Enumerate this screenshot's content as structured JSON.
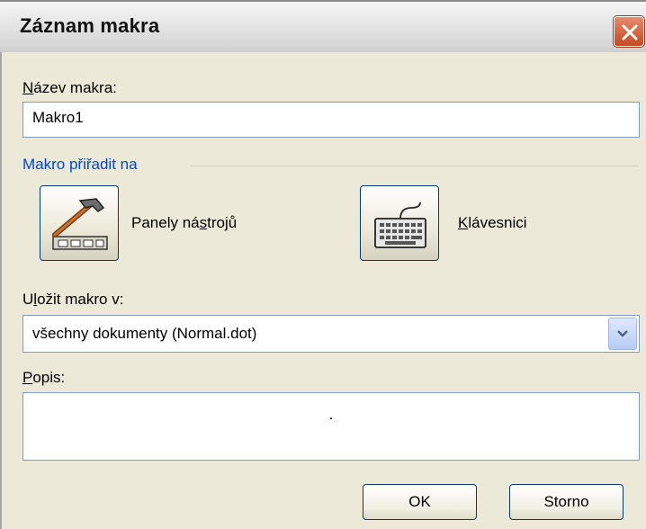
{
  "dialog": {
    "title": "Záznam makra",
    "close_label": "×"
  },
  "macro_name": {
    "label_accel": "N",
    "label_rest": "ázev makra:",
    "value": "Makro1"
  },
  "assign": {
    "group_label": "Makro přiřadit na",
    "toolbars": {
      "label_pre": "Panely ná",
      "label_accel": "s",
      "label_post": "trojů",
      "icon": "hammer-toolbar-icon"
    },
    "keyboard": {
      "label_accel": "K",
      "label_rest": "lávesnici",
      "icon": "keyboard-icon"
    }
  },
  "store_in": {
    "label_pre": "U",
    "label_accel": "l",
    "label_post": "ožit makro v:",
    "selected": "všechny dokumenty (Normal.dot)"
  },
  "description": {
    "label_accel": "P",
    "label_rest": "opis:",
    "value": "."
  },
  "buttons": {
    "ok": "OK",
    "cancel": "Storno"
  },
  "colors": {
    "dialog_bg": "#ece9d8",
    "group_label": "#0046d5",
    "close_button": "#c44a23"
  }
}
